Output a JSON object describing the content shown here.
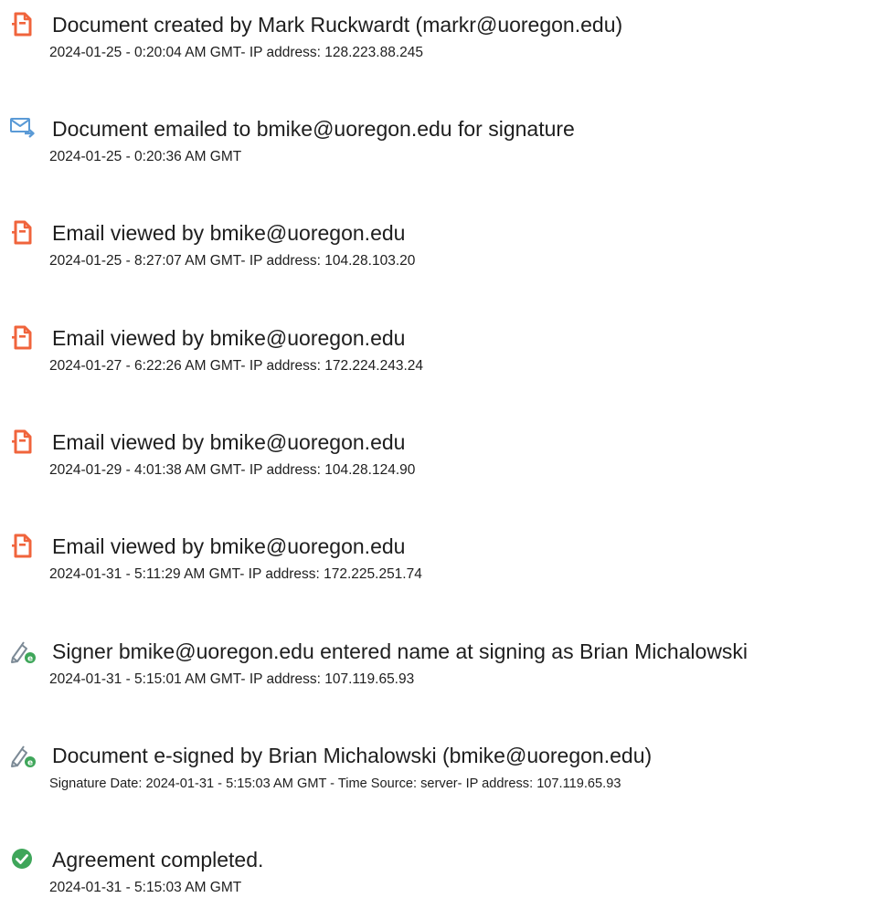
{
  "history": {
    "events": [
      {
        "icon": "document-created-icon",
        "title": "Document created by Mark Ruckwardt (markr@uoregon.edu)",
        "detail": "2024-01-25 - 0:20:04 AM GMT- IP address: 128.223.88.245"
      },
      {
        "icon": "email-sent-icon",
        "title": "Document emailed to bmike@uoregon.edu for signature",
        "detail": "2024-01-25 - 0:20:36 AM GMT"
      },
      {
        "icon": "document-viewed-icon",
        "title": "Email viewed by bmike@uoregon.edu",
        "detail": "2024-01-25 - 8:27:07 AM GMT- IP address: 104.28.103.20"
      },
      {
        "icon": "document-viewed-icon",
        "title": "Email viewed by bmike@uoregon.edu",
        "detail": "2024-01-27 - 6:22:26 AM GMT- IP address: 172.224.243.24"
      },
      {
        "icon": "document-viewed-icon",
        "title": "Email viewed by bmike@uoregon.edu",
        "detail": "2024-01-29 - 4:01:38 AM GMT- IP address: 104.28.124.90"
      },
      {
        "icon": "document-viewed-icon",
        "title": "Email viewed by bmike@uoregon.edu",
        "detail": "2024-01-31 - 5:11:29 AM GMT- IP address: 172.225.251.74"
      },
      {
        "icon": "e-signature-pen-icon",
        "title": "Signer bmike@uoregon.edu entered name at signing as Brian Michalowski",
        "detail": "2024-01-31 - 5:15:01 AM GMT- IP address: 107.119.65.93"
      },
      {
        "icon": "e-signature-pen-icon",
        "title": "Document e-signed by Brian Michalowski (bmike@uoregon.edu)",
        "detail": "Signature Date: 2024-01-31 - 5:15:03 AM GMT - Time Source: server- IP address: 107.119.65.93"
      },
      {
        "icon": "checkmark-circle-icon",
        "title": "Agreement completed.",
        "detail": "2024-01-31 - 5:15:03 AM GMT"
      }
    ]
  },
  "colors": {
    "document_icon": "#f0643c",
    "email_icon": "#5a9ad6",
    "signature_pen": "#7c8a96",
    "signature_badge": "#3fa65a",
    "completed": "#3fa65a",
    "text": "#1e1e1e"
  }
}
